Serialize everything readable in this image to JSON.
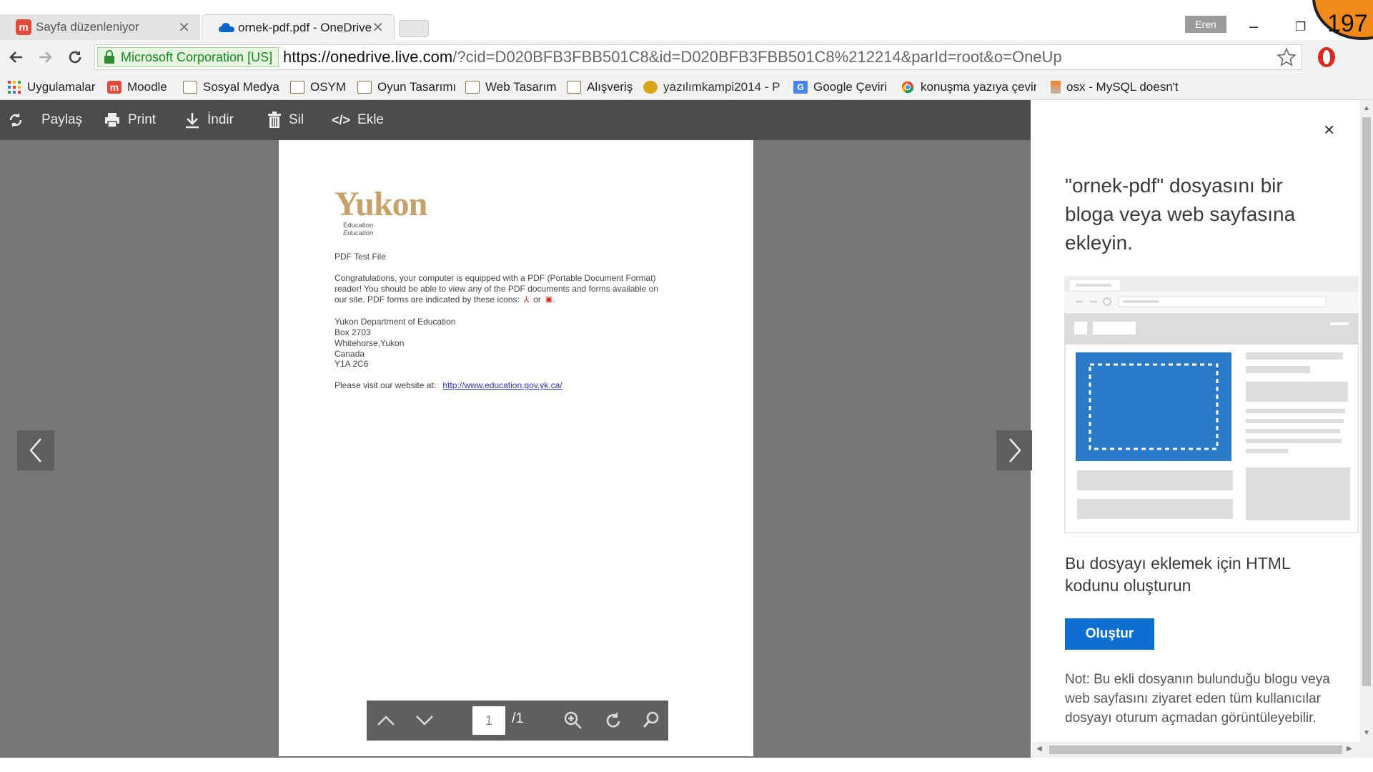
{
  "browser": {
    "tabs": [
      {
        "title": "Sayfa düzenleniyor",
        "icon": "moodle-icon",
        "active": false
      },
      {
        "title": "ornek-pdf.pdf - OneDrive",
        "icon": "onedrive-cloud-icon",
        "active": true
      }
    ],
    "profile_name": "Eren",
    "security_label": "Microsoft Corporation [US]",
    "url_domain": "https://onedrive.live.com",
    "url_rest": "/?cid=D020BFB3FBB501C8&id=D020BFB3FBB501C8%212214&parId=root&o=OneUp"
  },
  "bookmarks": [
    {
      "label": "Uygulamalar",
      "icon": "apps-grid-icon"
    },
    {
      "label": "Moodle",
      "icon": "moodle-icon"
    },
    {
      "label": "Sosyal Medya",
      "icon": "folder-icon"
    },
    {
      "label": "OSYM",
      "icon": "folder-icon"
    },
    {
      "label": "Oyun Tasarımı",
      "icon": "folder-icon"
    },
    {
      "label": "Web Tasarım",
      "icon": "folder-icon"
    },
    {
      "label": "Alışveriş",
      "icon": "folder-icon"
    },
    {
      "label": "yazılımkampi2014 - P",
      "icon": "bee-icon"
    },
    {
      "label": "Google Çeviri",
      "icon": "translate-icon"
    },
    {
      "label": "konuşma yazıya çevir",
      "icon": "chrome-icon"
    },
    {
      "label": "osx - MySQL doesn't",
      "icon": "stackoverflow-icon"
    }
  ],
  "commands": [
    {
      "label": "Paylaş",
      "icon": "share-icon"
    },
    {
      "label": "Print",
      "icon": "print-icon"
    },
    {
      "label": "İndir",
      "icon": "download-icon"
    },
    {
      "label": "Sil",
      "icon": "trash-icon"
    },
    {
      "label": "Ekle",
      "icon": "embed-code-icon"
    }
  ],
  "document": {
    "logo_word": "Yukon",
    "logo_sub1": "Education",
    "logo_sub2": "Éducation",
    "title": "PDF Test File",
    "body": [
      "Congratulations, your computer is equipped with a PDF (Portable Document Format)",
      "reader!  You should be able to view any of the PDF documents and forms available on",
      "our site.  PDF forms are indicated by these icons:"
    ],
    "icons_or": "or",
    "address": [
      "Yukon Department of Education",
      "Box 2703",
      "Whitehorse,Yukon",
      "Canada",
      "Y1A 2C6"
    ],
    "visit_text": "Please visit our website at:",
    "website": "http://www.education.gov.yk.ca/"
  },
  "pdf_controls": {
    "page_current": "1",
    "page_total": "/1"
  },
  "panel": {
    "heading": "\"ornek-pdf\" dosyasını bir\nbloga veya web sayfasına\nekleyin.",
    "subheading": "Bu dosyayı eklemek için HTML kodunu oluşturun",
    "button": "Oluştur",
    "note": "Not: Bu ekli dosyanın bulunduğu blogu veya web sayfasını ziyaret eden tüm kullanıcılar dosyayı oturum açmadan görüntüleyebilir.",
    "close": "×"
  },
  "overlay_counter": "197",
  "colors": {
    "command_bar": "#4c4c4c",
    "viewer_bg": "#767676",
    "primary_button": "#0f6fd1",
    "secure_green": "#138a1f",
    "yukon_gold": "#c7a16a"
  }
}
